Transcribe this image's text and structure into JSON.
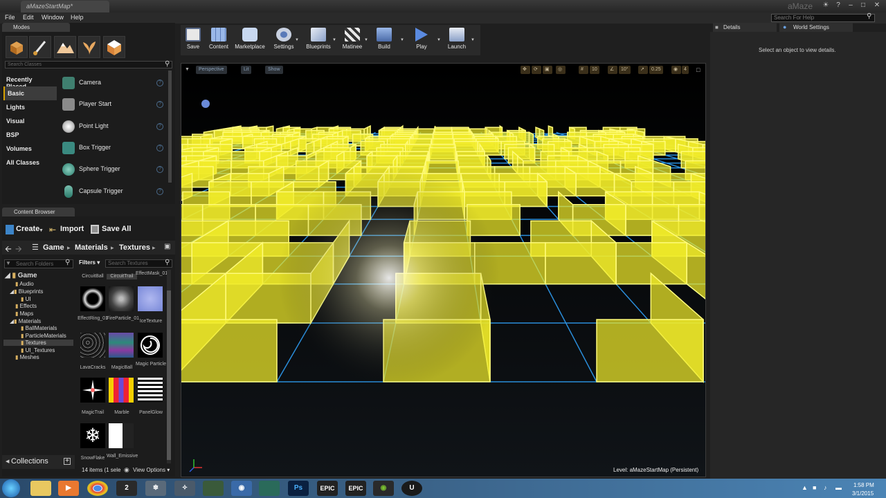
{
  "window": {
    "tab_title": "aMazeStartMap*",
    "app_name": "aMaze"
  },
  "menubar": {
    "items": [
      "File",
      "Edit",
      "Window",
      "Help"
    ],
    "search_placeholder": "Search For Help"
  },
  "modes": {
    "tab_label": "Modes",
    "search_placeholder": "Search Classes",
    "categories": [
      "Recently Placed",
      "Basic",
      "Lights",
      "Visual",
      "BSP",
      "Volumes",
      "All Classes"
    ],
    "active_category": "Basic",
    "items": [
      "Camera",
      "Player Start",
      "Point Light",
      "Box Trigger",
      "Sphere Trigger",
      "Capsule Trigger"
    ]
  },
  "content_browser": {
    "tab_label": "Content Browser",
    "create_label": "Create",
    "import_label": "Import",
    "save_all_label": "Save All",
    "path": [
      "Game",
      "Materials",
      "Textures"
    ],
    "folders_placeholder": "Search Folders",
    "filters_label": "Filters",
    "textures_placeholder": "Search Textures",
    "folders": [
      "Game",
      "Audio",
      "Blueprints",
      "UI",
      "Effects",
      "Maps",
      "Materials",
      "BallMaterials",
      "ParticleMaterials",
      "Textures",
      "UI_Textures",
      "Meshes"
    ],
    "assets": [
      "CircuitBall",
      "CircuitTrail",
      "EffectMask_01",
      "EffectRing_01",
      "FireParticle_01",
      "IceTexture",
      "LavaCracks",
      "MagicBall",
      "Magic Particle",
      "MagicTrail",
      "Marble",
      "PanelGlow",
      "SnowFlake",
      "Wall_Emissive"
    ],
    "collections_label": "Collections",
    "items_count": "14 items (1 sele",
    "view_options": "View Options"
  },
  "toolbar": {
    "buttons": [
      "Save",
      "Content",
      "Marketplace",
      "Settings",
      "Blueprints",
      "Matinee",
      "Build",
      "Play",
      "Launch"
    ]
  },
  "viewport": {
    "perspective": "Perspective",
    "lit": "Lit",
    "show": "Show",
    "snap_translate": "10",
    "snap_rotate": "10°",
    "snap_scale": "0.25",
    "camera_speed": "4",
    "level_label": "Level:  aMazeStartMap (Persistent)"
  },
  "details": {
    "tab_details": "Details",
    "tab_world": "World Settings",
    "empty_message": "Select an object to view details."
  },
  "taskbar": {
    "time": "1:58 PM",
    "date": "3/1/2015",
    "icons": [
      "start-orb",
      "explorer",
      "vlc",
      "chrome",
      "blender",
      "unity",
      "app6",
      "app7",
      "photoshop-ps",
      "epic",
      "epic2",
      "nvidia",
      "unreal"
    ]
  },
  "colors": {
    "maze_wall": "#f1ec2a",
    "grid_line": "#2e9bf0",
    "accent": "#d8a200"
  }
}
